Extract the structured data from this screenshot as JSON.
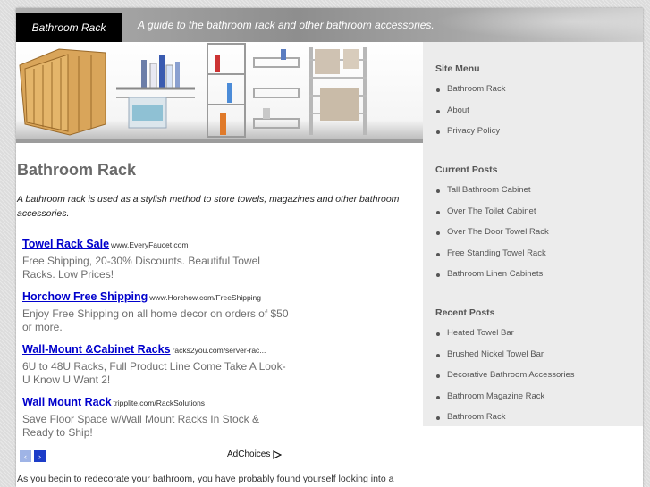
{
  "header": {
    "site_title": "Bathroom Rack",
    "tagline": "A guide to the bathroom rack and other bathroom accessories."
  },
  "main": {
    "title": "Bathroom Rack",
    "intro": "A bathroom rack is used as a stylish method to store towels, magazines and other bathroom accessories.",
    "ads": [
      {
        "title": "Towel Rack Sale",
        "url": "www.EveryFaucet.com",
        "desc": "Free Shipping, 20-30% Discounts. Beautiful Towel Racks. Low Prices!"
      },
      {
        "title": "Horchow Free Shipping",
        "url": "www.Horchow.com/FreeShipping",
        "desc": "Enjoy Free Shipping on all home decor on orders of $50 or more."
      },
      {
        "title": "Wall-Mount &Cabinet Racks",
        "url": "racks2you.com/server-rac...",
        "desc": "6U to 48U Racks, Full Product Line Come Take A Look- U Know U Want 2!"
      },
      {
        "title": "Wall Mount Rack",
        "url": "tripplite.com/RackSolutions",
        "desc": "Save Floor Space w/Wall Mount Racks In Stock & Ready to Ship!"
      }
    ],
    "ad_prev_icon": "‹",
    "ad_next_icon": "›",
    "adchoices_label": "AdChoices",
    "body_text": "As you begin to redecorate your bathroom, you have probably found yourself looking into a bathroom rack. They are perfect for organization, décor, and storage. Depending on the"
  },
  "sidebar": {
    "site_menu": {
      "heading": "Site Menu",
      "items": [
        "Bathroom Rack",
        "About",
        "Privacy Policy"
      ]
    },
    "current_posts": {
      "heading": "Current Posts",
      "items": [
        "Tall Bathroom Cabinet",
        "Over The Toilet Cabinet",
        "Over The Door Towel Rack",
        "Free Standing Towel Rack",
        "Bathroom Linen Cabinets"
      ]
    },
    "recent_posts": {
      "heading": "Recent Posts",
      "items": [
        "Heated Towel Bar",
        "Brushed Nickel Towel Bar",
        "Decorative Bathroom Accessories",
        "Bathroom Magazine Rack",
        "Bathroom Rack"
      ]
    }
  },
  "colors": {
    "link": "#0000cc",
    "header_title_bg": "#000000",
    "sidebar_bg": "#ececec"
  }
}
